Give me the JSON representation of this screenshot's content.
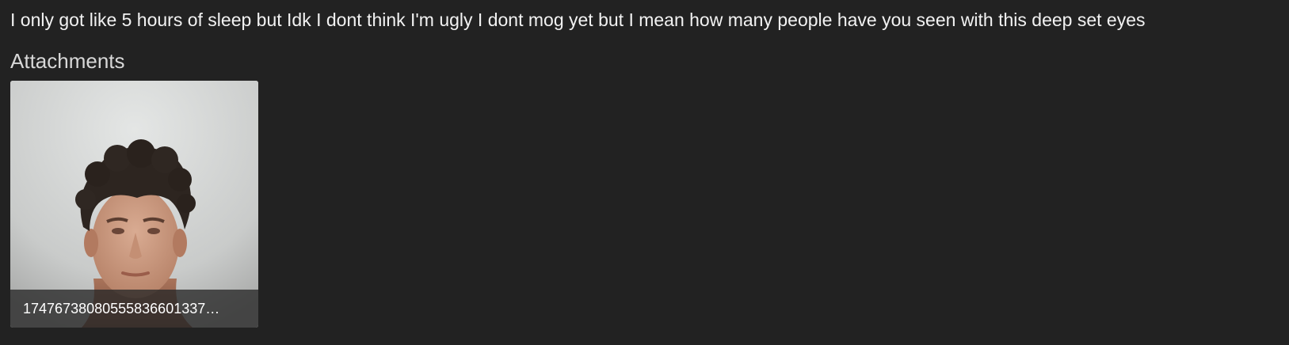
{
  "post": {
    "text": "I only got like 5 hours of sleep but Idk I dont think I'm ugly I dont mog yet but I mean how many people have you seen with this deep set eyes"
  },
  "attachments": {
    "heading": "Attachments",
    "items": [
      {
        "filename": "17476738080555836601337…",
        "thumbnail_icon": "portrait-photo-icon"
      }
    ]
  },
  "colors": {
    "background": "#222222",
    "text": "#f2f2f2",
    "heading": "#d8d8d8",
    "caption_overlay": "#282828"
  }
}
